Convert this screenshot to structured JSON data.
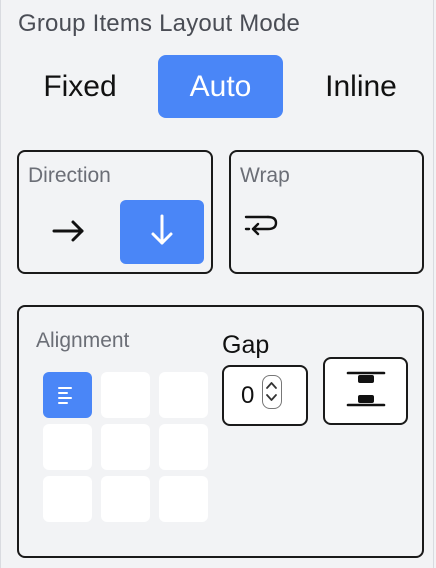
{
  "section": {
    "title": "Group Items Layout Mode"
  },
  "mode": {
    "options": [
      "Fixed",
      "Auto",
      "Inline"
    ],
    "selected": "Auto"
  },
  "direction": {
    "label": "Direction",
    "options": [
      {
        "icon": "arrow-right-icon",
        "selected": false
      },
      {
        "icon": "arrow-down-icon",
        "selected": true
      }
    ]
  },
  "wrap": {
    "label": "Wrap",
    "icon": "wrap-icon"
  },
  "alignment": {
    "label": "Alignment",
    "grid": {
      "rows": 3,
      "cols": 3,
      "selected_index": 0,
      "selected_icon": "align-left-icon"
    }
  },
  "gap": {
    "label": "Gap",
    "value": "0",
    "stepper_icon": "stepper-icon",
    "mode_icon": "space-between-icon"
  },
  "colors": {
    "accent": "#4a86f7",
    "background": "#f2f3f5",
    "border": "#1a1a1a",
    "label": "#6b6e76"
  }
}
